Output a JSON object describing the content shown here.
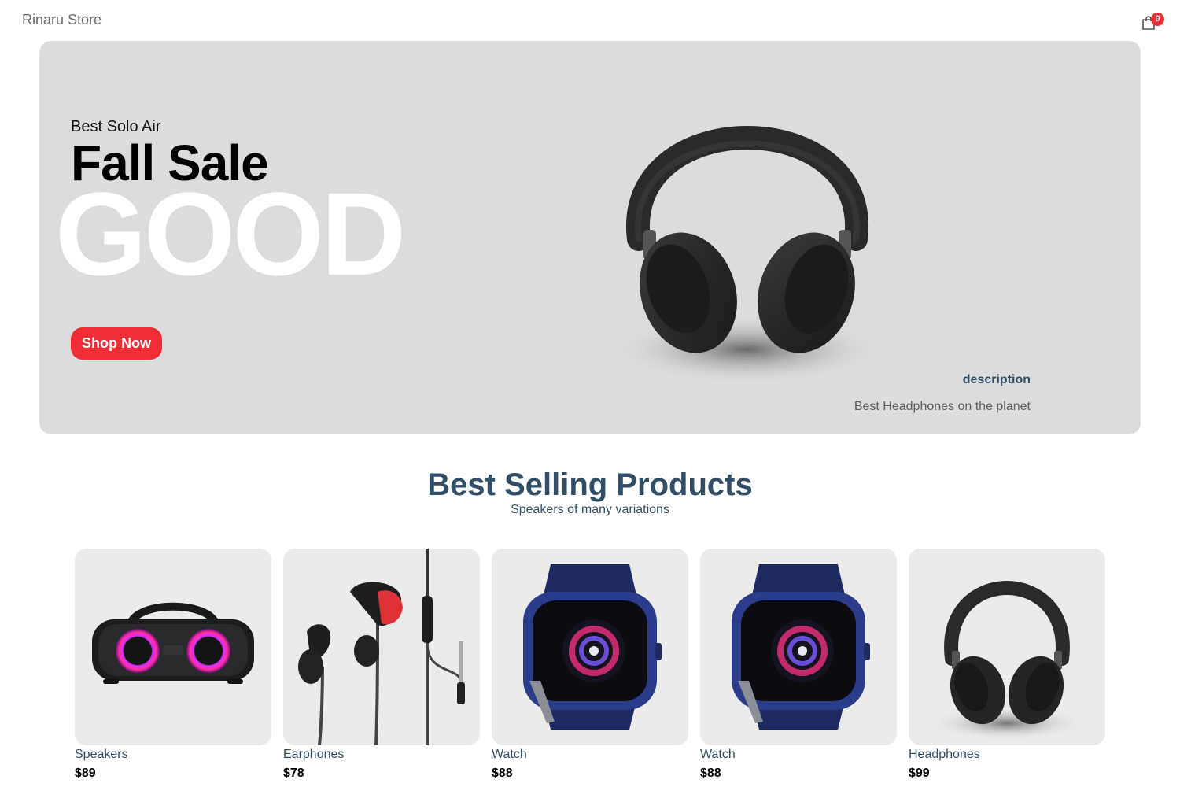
{
  "navbar": {
    "logo": "Rinaru Store",
    "cart_count": "0",
    "cart_icon": "shopping-bag-icon"
  },
  "hero": {
    "small_text": "Best Solo Air",
    "mid_text": "Fall Sale",
    "large_text": "GOOD",
    "button_label": "Shop Now",
    "desc_title": "description",
    "desc_text": "Best Headphones on the planet",
    "image": "headphones",
    "accent_color": "#f02d34"
  },
  "section": {
    "title": "Best Selling Products",
    "subtitle": "Speakers of many variations"
  },
  "products": [
    {
      "name": "Speakers",
      "price": "$89",
      "image": "speaker"
    },
    {
      "name": "Earphones",
      "price": "$78",
      "image": "earphones"
    },
    {
      "name": "Watch",
      "price": "$88",
      "image": "watch"
    },
    {
      "name": "Watch",
      "price": "$88",
      "image": "watch"
    },
    {
      "name": "Headphones",
      "price": "$99",
      "image": "headphones"
    }
  ]
}
